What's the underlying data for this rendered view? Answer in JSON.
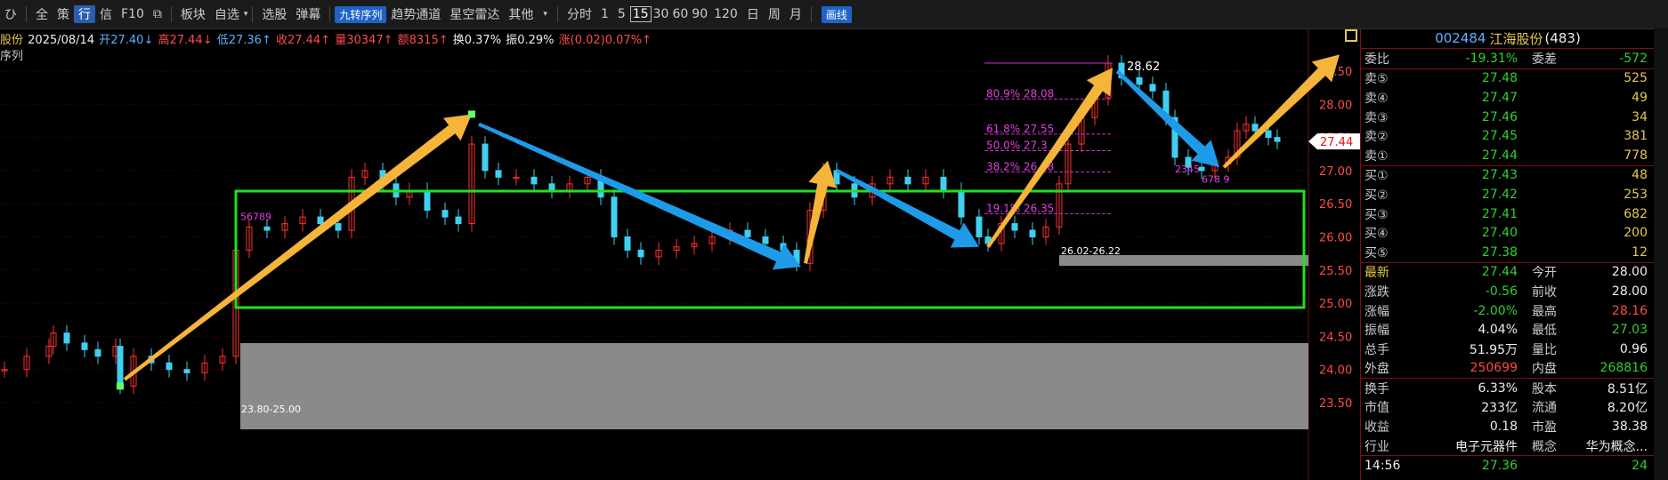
{
  "toolbar": {
    "items": [
      "ひ",
      "全",
      "策",
      "行",
      "信",
      "F10",
      "板块",
      "自选",
      "选股",
      "弹幕",
      "九转序列",
      "趋势通道",
      "星空雷达",
      "其他",
      "分时",
      "1",
      "5",
      "15",
      "30",
      "60",
      "90",
      "120",
      "日",
      "周",
      "月",
      "画线"
    ]
  },
  "stock_info": {
    "name_fragment": "股份",
    "date": "2025/08/14",
    "open": "开27.40↓",
    "high": "高27.44↓",
    "low": "低27.36↑",
    "close": "收27.44↑",
    "volume": "量30347↑",
    "amount": "额8315↑",
    "turnover": "换0.37%",
    "amplitude": "振0.29%",
    "change": "涨(0.02)0.07%↑",
    "indicator": "序列"
  },
  "chart_data": {
    "type": "candlestick",
    "y_axis_ticks": [
      "28.50",
      "28.00",
      "27.50",
      "27.00",
      "26.50",
      "26.00",
      "25.50",
      "25.00",
      "24.50",
      "24.00",
      "23.50"
    ],
    "current_price": "27.44",
    "annotations": {
      "high_label": "28.62",
      "fib": [
        "80.9% 28.08",
        "61.8% 27.55",
        "50.0% 27.3",
        "38.2% 26.98",
        "19.1% 26.35"
      ],
      "zone_upper": "26.02-26.22",
      "zone_lower": "23.80-25.00",
      "seq_left": "56789",
      "seq_right": "2345",
      "seq_r2": "678 9"
    }
  },
  "quote_panel": {
    "code": "002484",
    "name": "江海股份",
    "count": "(483)",
    "weibi": {
      "label": "委比",
      "value": "-19.31%",
      "label2": "委差",
      "value2": "-572"
    },
    "sell": [
      {
        "label": "卖⑤",
        "price": "27.48",
        "vol": "525"
      },
      {
        "label": "卖④",
        "price": "27.47",
        "vol": "49"
      },
      {
        "label": "卖③",
        "price": "27.46",
        "vol": "34"
      },
      {
        "label": "卖②",
        "price": "27.45",
        "vol": "381"
      },
      {
        "label": "卖①",
        "price": "27.44",
        "vol": "778"
      }
    ],
    "buy": [
      {
        "label": "买①",
        "price": "27.43",
        "vol": "48"
      },
      {
        "label": "买②",
        "price": "27.42",
        "vol": "253"
      },
      {
        "label": "买③",
        "price": "27.41",
        "vol": "682"
      },
      {
        "label": "买④",
        "price": "27.40",
        "vol": "200"
      },
      {
        "label": "买⑤",
        "price": "27.38",
        "vol": "12"
      }
    ],
    "stats": [
      {
        "l": "最新",
        "p": "27.44",
        "l2": "今开",
        "v": "28.00"
      },
      {
        "l": "涨跌",
        "p": "-0.56",
        "l2": "前收",
        "v": "28.00"
      },
      {
        "l": "涨幅",
        "p": "-2.00%",
        "l2": "最高",
        "v": "28.16"
      },
      {
        "l": "振幅",
        "p": "4.04%",
        "l2": "最低",
        "v": "27.03"
      },
      {
        "l": "总手",
        "p": "51.95万",
        "l2": "量比",
        "v": "0.96"
      },
      {
        "l": "外盘",
        "p": "250699",
        "l2": "内盘",
        "v": "268816"
      }
    ],
    "stats2": [
      {
        "l": "换手",
        "p": "6.33%",
        "l2": "股本",
        "v": "8.51亿"
      },
      {
        "l": "市值",
        "p": "233亿",
        "l2": "流通",
        "v": "8.20亿"
      },
      {
        "l": "收益",
        "p": "0.18",
        "l2": "市盈",
        "v": "38.38"
      },
      {
        "l": "行业",
        "p": "电子元器件",
        "l2": "概念",
        "v": "华为概念..."
      }
    ],
    "time": "14:56",
    "time_price": "27.36",
    "time_vol": "24"
  }
}
